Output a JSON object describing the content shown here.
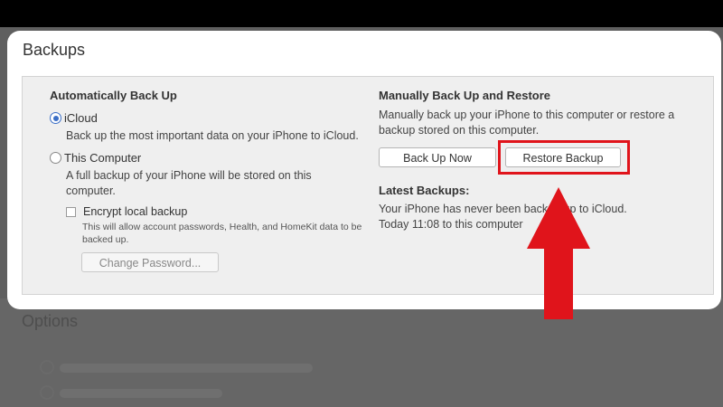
{
  "background": {
    "options_title": "Options"
  },
  "panel": {
    "title": "Backups"
  },
  "auto": {
    "heading": "Automatically Back Up",
    "icloud": {
      "label": "iCloud",
      "desc": "Back up the most important data on your iPhone to iCloud."
    },
    "computer": {
      "label": "This Computer",
      "desc_line1": "A full backup of your iPhone will be stored on this",
      "desc_line2": "computer."
    },
    "encrypt": {
      "label": "Encrypt local backup",
      "desc_line1": "This will allow account passwords, Health, and HomeKit data to be",
      "desc_line2": "backed up."
    },
    "change_password_label": "Change Password..."
  },
  "manual": {
    "heading": "Manually Back Up and Restore",
    "desc_line1": "Manually back up your iPhone to this computer or restore a",
    "desc_line2": "backup stored on this computer.",
    "back_up_now_label": "Back Up Now",
    "restore_backup_label": "Restore Backup"
  },
  "latest": {
    "heading": "Latest Backups:",
    "line1": "Your iPhone has never been backed up to iCloud.",
    "line2": "Today 11:08 to this computer"
  },
  "colors": {
    "highlight": "#e0141b",
    "arrow": "#e0141b",
    "radio_accent": "#3b6fc6"
  }
}
